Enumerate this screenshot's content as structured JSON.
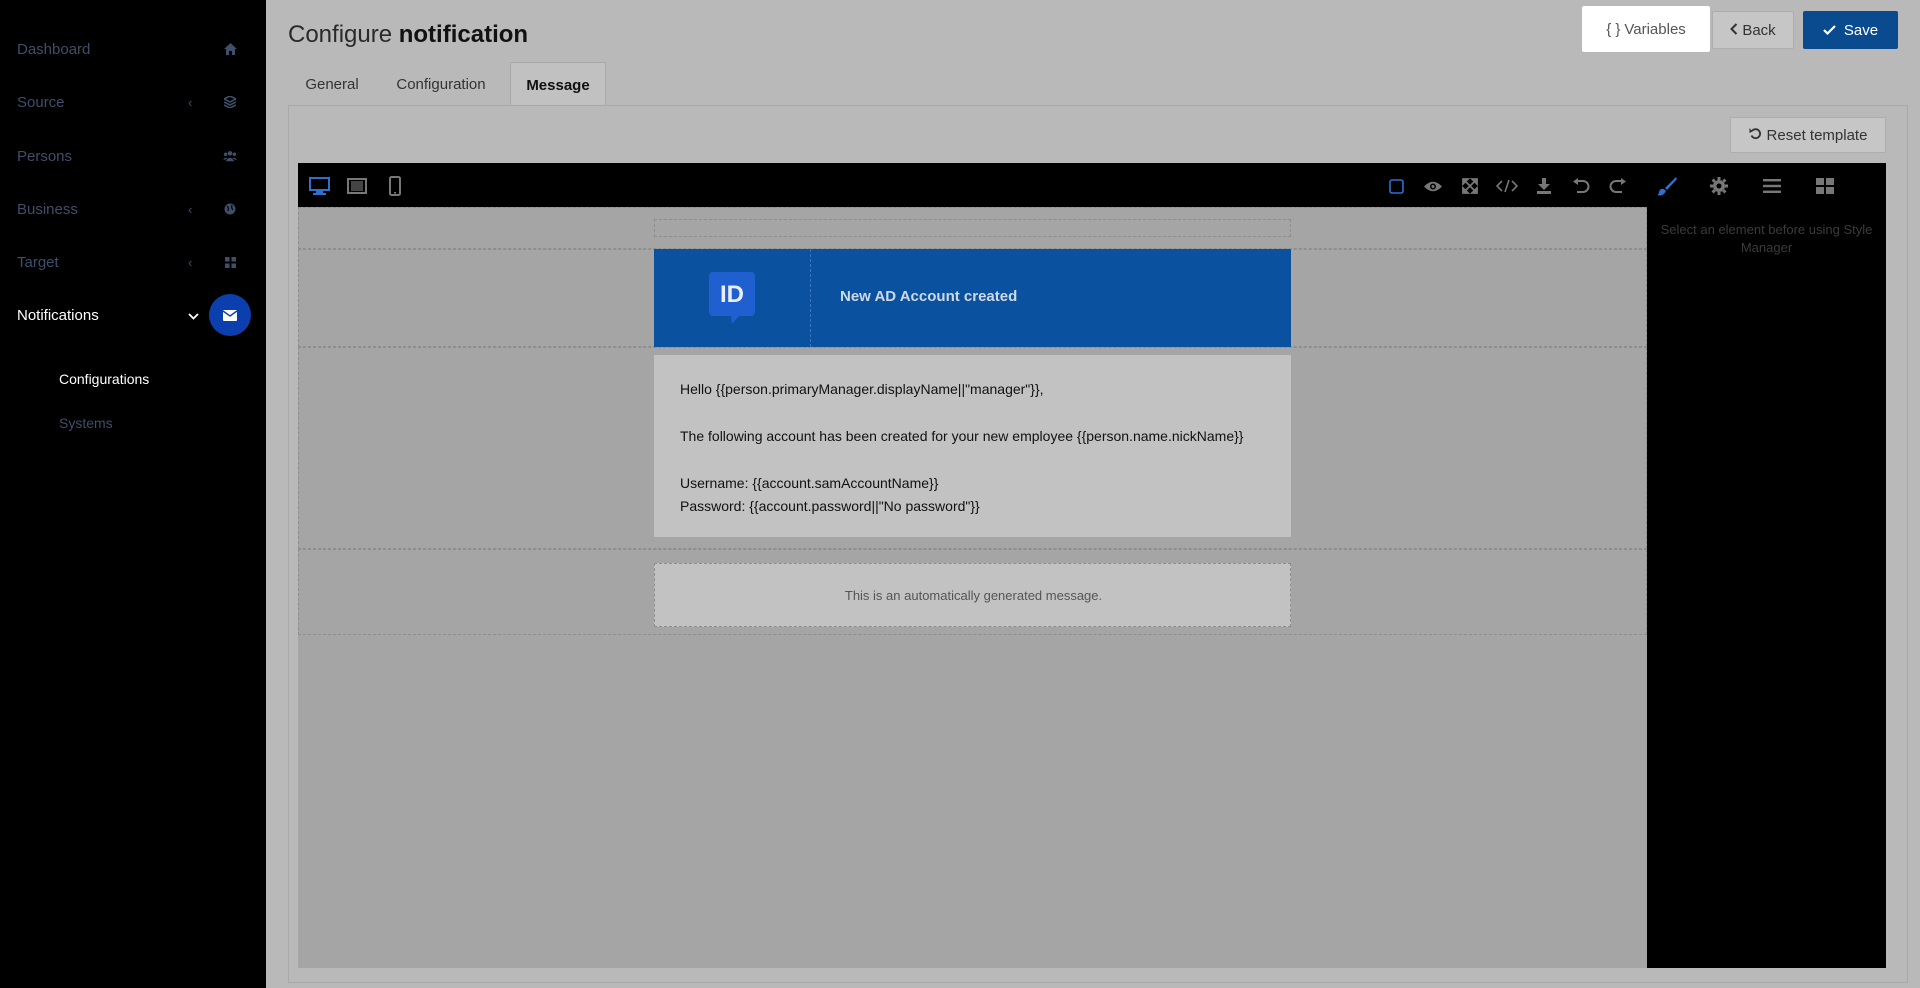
{
  "sidebar": {
    "items": [
      {
        "label": "Dashboard",
        "icon": "home-icon"
      },
      {
        "label": "Source",
        "icon": "layers-icon"
      },
      {
        "label": "Persons",
        "icon": "users-icon"
      },
      {
        "label": "Business",
        "icon": "globe-icon"
      },
      {
        "label": "Target",
        "icon": "grid-icon"
      },
      {
        "label": "Notifications",
        "icon": "envelope-icon"
      }
    ],
    "subitems": [
      {
        "label": "Configurations"
      },
      {
        "label": "Systems"
      }
    ]
  },
  "header": {
    "title_prefix": "Configure",
    "title_bold": "notification",
    "variables_label": "Variables",
    "back_label": "Back",
    "save_label": "Save"
  },
  "tabs": [
    {
      "label": "General"
    },
    {
      "label": "Configuration"
    },
    {
      "label": "Message"
    }
  ],
  "panel": {
    "reset_label": "Reset template"
  },
  "editor": {
    "style_manager_hint": "Select an element before using Style Manager",
    "email": {
      "logo_text": "ID",
      "header_title": "New AD Account created",
      "greeting": "Hello {{person.primaryManager.displayName||\"manager\"}},",
      "line1": "The following account has been created for your new employee {{person.name.nickName}}",
      "username": "Username: {{account.samAccountName}}",
      "password": "Password: {{account.password||\"No password\"}}",
      "footer": "This is an automatically generated message."
    }
  },
  "colors": {
    "accent_blue": "#0a4b8f",
    "email_header": "#0a52a0",
    "active_badge": "#0c3fae",
    "sidebar_bg": "#000000"
  }
}
